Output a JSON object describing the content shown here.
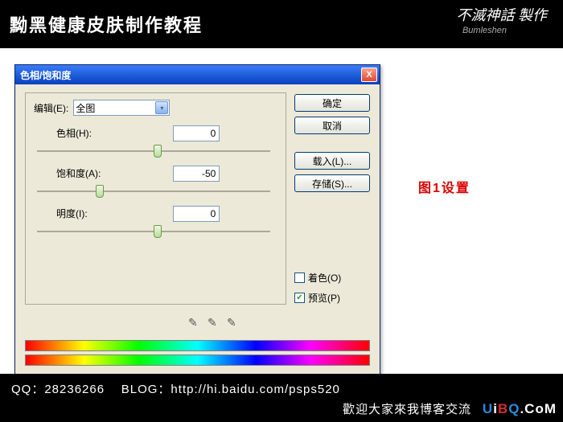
{
  "banner": {
    "title": "黝黑健康皮肤制作教程",
    "logo": "不滅神話 製作",
    "logo_sub": "Bumleshen"
  },
  "dialog": {
    "title": "色相/饱和度",
    "close": "X",
    "edit": {
      "label": "编辑(E):",
      "value": "全图"
    },
    "hue": {
      "label": "色相(H):",
      "value": "0",
      "pos": 50
    },
    "sat": {
      "label": "饱和度(A):",
      "value": "-50",
      "pos": 25
    },
    "light": {
      "label": "明度(I):",
      "value": "0",
      "pos": 50
    },
    "buttons": {
      "ok": "确定",
      "cancel": "取消",
      "load": "载入(L)...",
      "save": "存储(S)..."
    },
    "colorize": {
      "label": "着色(O)",
      "checked": false
    },
    "preview": {
      "label": "预览(P)",
      "checked": true
    }
  },
  "annotation": "图1设置",
  "footer": {
    "qq": "QQ：28236266",
    "blog": "BLOG：http://hi.baidu.com/psps520",
    "welcome": "歡迎大家來我博客交流"
  },
  "watermark": {
    "u": "U",
    "i": "i",
    "b": "B",
    "q": "Q",
    "c": ".CoM"
  }
}
